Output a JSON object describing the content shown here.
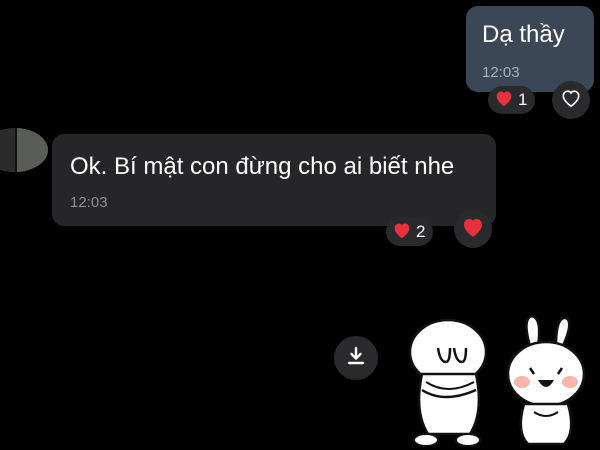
{
  "outgoing_message": {
    "text": "Dạ thầy",
    "time": "12:03",
    "reaction": {
      "icon": "heart-icon",
      "count": "1"
    }
  },
  "incoming_message": {
    "text": "Ok. Bí mật con đừng cho ai biết nhe",
    "time": "12:03",
    "reaction": {
      "icon": "heart-icon",
      "count": "2"
    }
  },
  "sticker": {
    "icon": "sticker-image"
  },
  "colors": {
    "background": "#000000",
    "outgoing_bubble": "#3b4656",
    "incoming_bubble": "#262628",
    "heart": "#e8313f"
  }
}
